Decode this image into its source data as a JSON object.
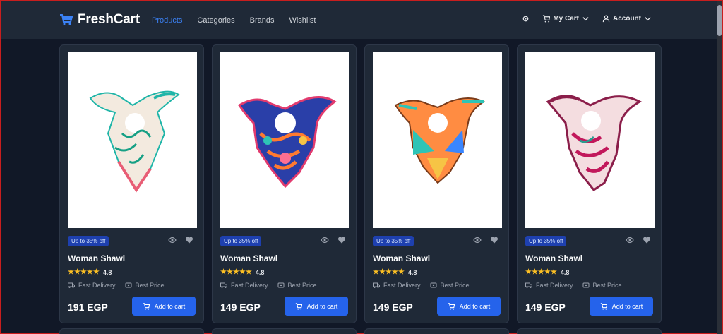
{
  "brand": {
    "name": "FreshCart"
  },
  "nav": {
    "links": [
      {
        "label": "Products",
        "active": true
      },
      {
        "label": "Categories"
      },
      {
        "label": "Brands"
      },
      {
        "label": "Wishlist"
      }
    ],
    "cart_label": "My Cart",
    "account_label": "Account"
  },
  "products": [
    {
      "badge": "Up to 35% off",
      "title": "Woman Shawl",
      "rating": "4.8",
      "fast": "Fast Delivery",
      "best": "Best Price",
      "price": "191 EGP",
      "cta": "Add to cart",
      "image": "scarf-teal"
    },
    {
      "badge": "Up to 35% off",
      "title": "Woman Shawl",
      "rating": "4.8",
      "fast": "Fast Delivery",
      "best": "Best Price",
      "price": "149 EGP",
      "cta": "Add to cart",
      "image": "scarf-navy"
    },
    {
      "badge": "Up to 35% off",
      "title": "Woman Shawl",
      "rating": "4.8",
      "fast": "Fast Delivery",
      "best": "Best Price",
      "price": "149 EGP",
      "cta": "Add to cart",
      "image": "scarf-orange"
    },
    {
      "badge": "Up to 35% off",
      "title": "Woman Shawl",
      "rating": "4.8",
      "fast": "Fast Delivery",
      "best": "Best Price",
      "price": "149 EGP",
      "cta": "Add to cart",
      "image": "scarf-magenta"
    }
  ],
  "colors": {
    "accent": "#2563eb",
    "background": "#111827",
    "card": "#1f2937",
    "star": "#fbbf24"
  }
}
